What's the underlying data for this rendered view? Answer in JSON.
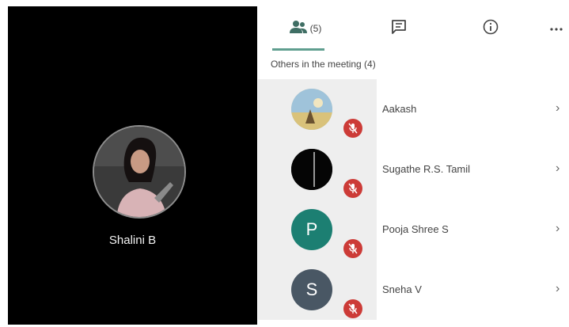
{
  "self_tile": {
    "name": "Shalini B"
  },
  "tabs": {
    "people_count": "(5)"
  },
  "participants_panel": {
    "section_title": "Others in the meeting (4)",
    "participants": [
      {
        "name": "Aakash",
        "avatar_type": "photo",
        "avatar_letter": "",
        "avatar_color": "#d6cfa4"
      },
      {
        "name": "Sugathe R.S. Tamil",
        "avatar_type": "photo",
        "avatar_letter": "",
        "avatar_color": "#050505"
      },
      {
        "name": "Pooja Shree S",
        "avatar_type": "letter",
        "avatar_letter": "P",
        "avatar_color": "#1c7f72"
      },
      {
        "name": "Sneha V",
        "avatar_type": "letter",
        "avatar_letter": "S",
        "avatar_color": "#495764"
      }
    ]
  },
  "colors": {
    "accent": "#5f9e8f",
    "muted_badge": "#cc3b37"
  },
  "icons": [
    "people-icon",
    "chat-icon",
    "info-icon",
    "more-icon",
    "mic-off-icon",
    "chevron-right-icon"
  ]
}
